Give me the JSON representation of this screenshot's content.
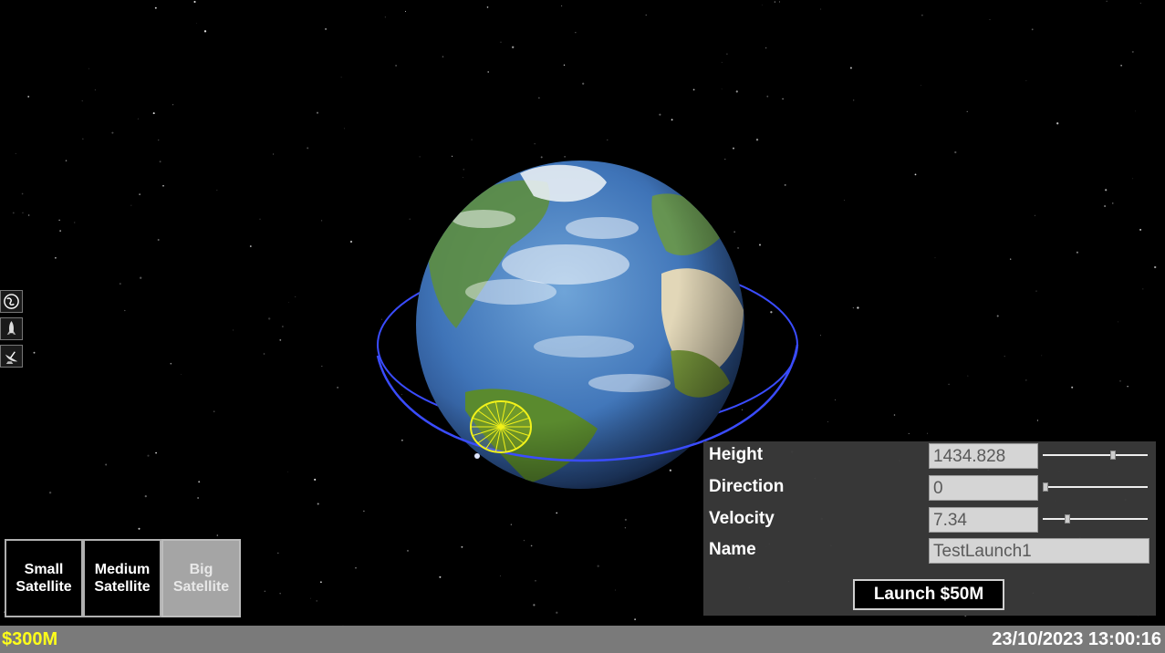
{
  "side_toolbar": {
    "icons": [
      "earth-icon",
      "rocket-icon",
      "satellite-dish-icon"
    ]
  },
  "launch_panel": {
    "fields": [
      {
        "label": "Height",
        "value": "1434.828",
        "slider_fraction": 0.68
      },
      {
        "label": "Direction",
        "value": "0",
        "slider_fraction": 0.0
      },
      {
        "label": "Velocity",
        "value": "7.34",
        "slider_fraction": 0.22
      }
    ],
    "name_label": "Name",
    "name_value": "TestLaunch1",
    "launch_label": "Launch $50M"
  },
  "satellite_types": [
    {
      "line1": "Small",
      "line2": "Satellite",
      "selected": false
    },
    {
      "line1": "Medium",
      "line2": "Satellite",
      "selected": false
    },
    {
      "line1": "Big",
      "line2": "Satellite",
      "selected": true
    }
  ],
  "status": {
    "money": "$300M",
    "datetime": "23/10/2023 13:00:16"
  },
  "colors": {
    "orbit": "#3a4cff",
    "footprint": "#f2f21a",
    "money": "#ffff1a"
  }
}
